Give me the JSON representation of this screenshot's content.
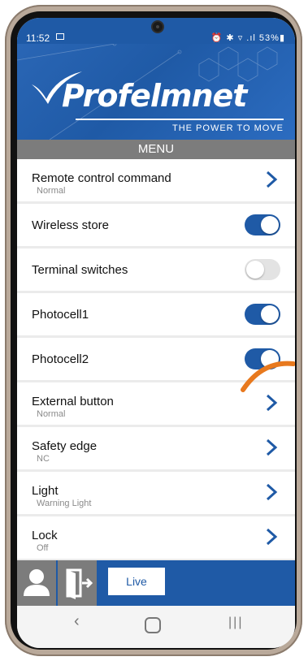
{
  "status_bar": {
    "time": "11:52",
    "right_icons": "⏰ ✱ ▿ .ıl",
    "battery": "53%"
  },
  "banner": {
    "brand": "Profelmnet",
    "tagline": "THE POWER TO MOVE"
  },
  "menu": {
    "header": "MENU",
    "items": [
      {
        "title": "Remote control command",
        "sub": "Normal",
        "control": "chevron"
      },
      {
        "title": "Wireless store",
        "control": "toggle",
        "on": true
      },
      {
        "title": "Terminal switches",
        "control": "toggle",
        "on": false
      },
      {
        "title": "Photocell1",
        "control": "toggle",
        "on": true
      },
      {
        "title": "Photocell2",
        "control": "toggle",
        "on": true
      },
      {
        "title": "External button",
        "sub": "Normal",
        "control": "chevron"
      },
      {
        "title": "Safety edge",
        "sub": "NC",
        "control": "chevron"
      },
      {
        "title": "Light",
        "sub": "Warning Light",
        "control": "chevron"
      },
      {
        "title": "Lock",
        "sub": "Off",
        "control": "chevron"
      }
    ]
  },
  "bottom_bar": {
    "live_label": "Live",
    "user_icon": "user-icon",
    "exit_icon": "exit-icon"
  },
  "colors": {
    "brand_blue": "#1f5aa6",
    "header_gray": "#7c7c7c",
    "annotation_orange": "#e8791e"
  }
}
